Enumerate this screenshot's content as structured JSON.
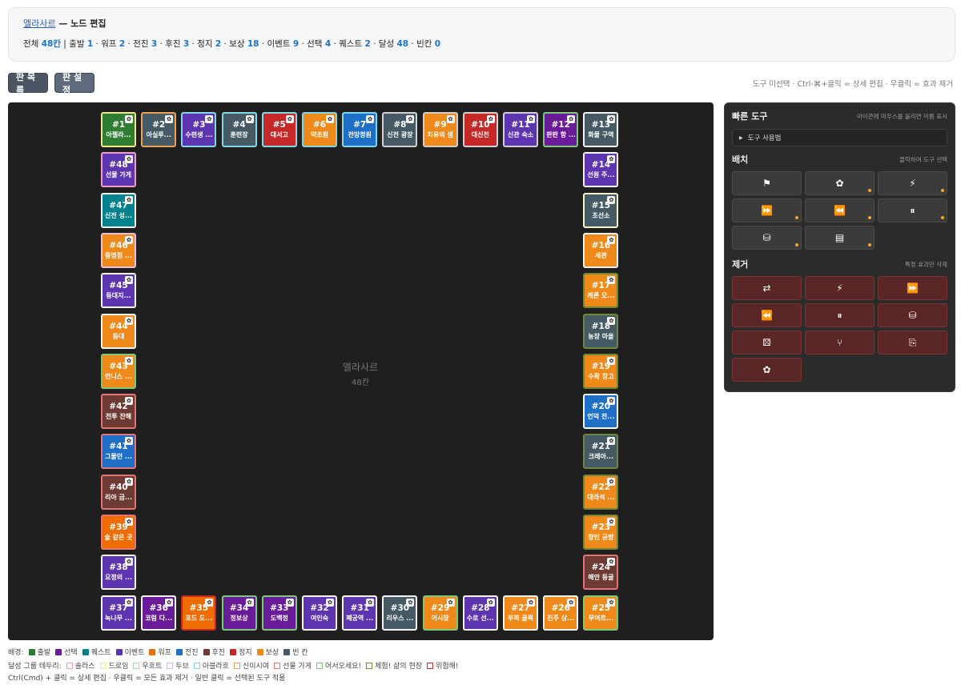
{
  "header": {
    "board_link": "엘라사르",
    "title_rest": " — 노드 편집",
    "stats": [
      {
        "label": "전체",
        "value": "48칸"
      },
      {
        "label": "출발",
        "value": "1"
      },
      {
        "label": "워프",
        "value": "2"
      },
      {
        "label": "전진",
        "value": "3"
      },
      {
        "label": "후진",
        "value": "3"
      },
      {
        "label": "정지",
        "value": "2"
      },
      {
        "label": "보상",
        "value": "18"
      },
      {
        "label": "이벤트",
        "value": "9"
      },
      {
        "label": "선택",
        "value": "4"
      },
      {
        "label": "퀘스트",
        "value": "2"
      },
      {
        "label": "달성",
        "value": "48"
      },
      {
        "label": "빈칸",
        "value": "0"
      }
    ]
  },
  "toolbar": {
    "board_list_label": "판 목록",
    "board_settings_label": "판 설정",
    "hint": "도구 미선택 · Ctrl-⌘+클릭 = 상세 편집 · 우클릭 = 효과 제거"
  },
  "board": {
    "name": "엘라사르",
    "count": "48칸",
    "tiles": [
      {
        "num": "#1",
        "name": "아젤라...",
        "bg": "#2e7d32",
        "border": "#f0e68c",
        "icon": "✿"
      },
      {
        "num": "#2",
        "name": "아실루...",
        "bg": "#455a64",
        "border": "#f0a050",
        "icon": "✿"
      },
      {
        "num": "#3",
        "name": "수련생 ...",
        "bg": "#5e35b1",
        "border": "#7fd8e8",
        "icon": "✿"
      },
      {
        "num": "#4",
        "name": "훈련장",
        "bg": "#455a64",
        "border": "#7fd8e8",
        "icon": "✿"
      },
      {
        "num": "#5",
        "name": "대서고",
        "bg": "#c62828",
        "border": "#7fd8e8",
        "icon": "✿"
      },
      {
        "num": "#6",
        "name": "약초원",
        "bg": "#ef8a1a",
        "border": "#7fd8e8",
        "icon": "✿"
      },
      {
        "num": "#7",
        "name": "전망정원",
        "bg": "#1e6fc7",
        "border": "#7fd8e8",
        "icon": "✿"
      },
      {
        "num": "#8",
        "name": "신전 광장",
        "bg": "#455a64",
        "border": "#d0d0d0",
        "icon": "✿"
      },
      {
        "num": "#9",
        "name": "치유의 샘",
        "bg": "#ef8a1a",
        "border": "#d0d0d0",
        "icon": "✿"
      },
      {
        "num": "#10",
        "name": "대신전",
        "bg": "#c62828",
        "border": "#d0d0d0",
        "icon": "✿"
      },
      {
        "num": "#11",
        "name": "신관 숙소",
        "bg": "#5e35b1",
        "border": "#d0d0d0",
        "icon": "✿"
      },
      {
        "num": "#12",
        "name": "판판 항 ...",
        "bg": "#6a1b9a",
        "border": "#7ec87e",
        "icon": "✿"
      },
      {
        "num": "#13",
        "name": "화물 구역",
        "bg": "#455a64",
        "border": "#f5f5f5",
        "icon": "✿"
      },
      {
        "num": "#14",
        "name": "선원 주...",
        "bg": "#5e35b1",
        "border": "#f5f5f5",
        "icon": "✿"
      },
      {
        "num": "#15",
        "name": "조선소",
        "bg": "#455a64",
        "border": "#f5f5c8",
        "icon": "✿"
      },
      {
        "num": "#16",
        "name": "세관",
        "bg": "#ef8a1a",
        "border": "#f5f5f5",
        "icon": "✿"
      },
      {
        "num": "#17",
        "name": "케른 오...",
        "bg": "#ef8a1a",
        "border": "#6a8a3a",
        "icon": "✿"
      },
      {
        "num": "#18",
        "name": "농장 마을",
        "bg": "#455a64",
        "border": "#6a8a3a",
        "icon": "✿"
      },
      {
        "num": "#19",
        "name": "수확 창고",
        "bg": "#ef8a1a",
        "border": "#6a8a3a",
        "icon": "✿"
      },
      {
        "num": "#20",
        "name": "언덕 전...",
        "bg": "#1e6fc7",
        "border": "#f5f5f5",
        "icon": "✿"
      },
      {
        "num": "#21",
        "name": "크레아...",
        "bg": "#455a64",
        "border": "#6a8a3a",
        "icon": "✿"
      },
      {
        "num": "#22",
        "name": "대라석 ...",
        "bg": "#ef8a1a",
        "border": "#6a8a3a",
        "icon": "✿"
      },
      {
        "num": "#23",
        "name": "장인 공방",
        "bg": "#ef8a1a",
        "border": "#6a8a3a",
        "icon": "✿"
      },
      {
        "num": "#24",
        "name": "해안 등굴",
        "bg": "#6d3b33",
        "border": "#e57373",
        "icon": "✿"
      },
      {
        "num": "#25",
        "name": "무여르...",
        "bg": "#ef8a1a",
        "border": "#7ec87e",
        "icon": "✿"
      },
      {
        "num": "#26",
        "name": "진주 상...",
        "bg": "#ef8a1a",
        "border": "#f5f5f5",
        "icon": "✿"
      },
      {
        "num": "#27",
        "name": "부적 골목",
        "bg": "#ef8a1a",
        "border": "#f5f5f5",
        "icon": "✿"
      },
      {
        "num": "#28",
        "name": "수로 선...",
        "bg": "#5e35b1",
        "border": "#f5f5f5",
        "icon": "✿"
      },
      {
        "num": "#29",
        "name": "어시장",
        "bg": "#ef8a1a",
        "border": "#7ec87e",
        "icon": "✿"
      },
      {
        "num": "#30",
        "name": "리우스 ...",
        "bg": "#455a64",
        "border": "#f5f5f5",
        "icon": "✿"
      },
      {
        "num": "#31",
        "name": "폐궁역 ...",
        "bg": "#5e35b1",
        "border": "#f5f5f5",
        "icon": "✿"
      },
      {
        "num": "#32",
        "name": "여인숙",
        "bg": "#5e35b1",
        "border": "#f5f5f5",
        "icon": "✿"
      },
      {
        "num": "#33",
        "name": "도백정",
        "bg": "#6a1b9a",
        "border": "#7ec87e",
        "icon": "✿"
      },
      {
        "num": "#34",
        "name": "정보상",
        "bg": "#6a1b9a",
        "border": "#7ec87e",
        "icon": "✿"
      },
      {
        "num": "#35",
        "name": "포드 도...",
        "bg": "#ef6c00",
        "border": "#c62828",
        "icon": "✿"
      },
      {
        "num": "#36",
        "name": "코럼 다...",
        "bg": "#6a1b9a",
        "border": "#f5f5f5",
        "icon": "✿"
      },
      {
        "num": "#37",
        "name": "녹나무 ...",
        "bg": "#5e35b1",
        "border": "#f5f5f5",
        "icon": "✿"
      },
      {
        "num": "#38",
        "name": "요정의 ...",
        "bg": "#5e35b1",
        "border": "#f5f5f5",
        "icon": "✿"
      },
      {
        "num": "#39",
        "name": "술 같은 곳",
        "bg": "#ef6c00",
        "border": "#e57373",
        "icon": "✿"
      },
      {
        "num": "#40",
        "name": "리아 금...",
        "bg": "#6d3b33",
        "border": "#e57373",
        "icon": "✿"
      },
      {
        "num": "#41",
        "name": "그물던 ...",
        "bg": "#1e6fc7",
        "border": "#e57373",
        "icon": "✿"
      },
      {
        "num": "#42",
        "name": "전투 잔해",
        "bg": "#6d3b33",
        "border": "#e57373",
        "icon": "✿"
      },
      {
        "num": "#43",
        "name": "언니스 ...",
        "bg": "#ef8a1a",
        "border": "#7ec87e",
        "icon": "✿"
      },
      {
        "num": "#44",
        "name": "등대",
        "bg": "#ef8a1a",
        "border": "#f5f5f5",
        "icon": "✿"
      },
      {
        "num": "#45",
        "name": "등대지...",
        "bg": "#5e35b1",
        "border": "#f5f5f5",
        "icon": "✿"
      },
      {
        "num": "#46",
        "name": "증명점 ...",
        "bg": "#ef8a1a",
        "border": "#f0c0e0",
        "icon": "✿"
      },
      {
        "num": "#47",
        "name": "신전 성...",
        "bg": "#00838f",
        "border": "#f5f5f5",
        "icon": "✿"
      },
      {
        "num": "#48",
        "name": "선물 가게",
        "bg": "#5e35b1",
        "border": "#f0a0c8",
        "icon": "✿"
      }
    ]
  },
  "panel": {
    "quick_tools_title": "빠른 도구",
    "quick_tools_hint": "아이콘에 마우스를 올리면 이름 표시",
    "usage_label": "도구 사용법",
    "placement_title": "배치",
    "placement_hint": "클릭하여 도구 선택",
    "placement_tools": [
      {
        "icon": "flag-icon",
        "glyph": "⚑",
        "dot": false
      },
      {
        "icon": "award-icon",
        "glyph": "✿",
        "dot": true
      },
      {
        "icon": "bolt-icon",
        "glyph": "⚡",
        "dot": true
      },
      {
        "icon": "fast-forward-icon",
        "glyph": "⏩",
        "dot": true
      },
      {
        "icon": "rewind-icon",
        "glyph": "⏪",
        "dot": true
      },
      {
        "icon": "pause-icon",
        "glyph": "⏸",
        "dot": true
      },
      {
        "icon": "coins-icon",
        "glyph": "⛁",
        "dot": true
      },
      {
        "icon": "chest-icon",
        "glyph": "▤",
        "dot": true
      }
    ],
    "remove_title": "제거",
    "remove_hint": "특정 효과만 삭제",
    "remove_tools": [
      {
        "icon": "swap-icon",
        "glyph": "⇄"
      },
      {
        "icon": "bolt-icon",
        "glyph": "⚡"
      },
      {
        "icon": "fast-forward-icon",
        "glyph": "⏩"
      },
      {
        "icon": "rewind-icon",
        "glyph": "⏪"
      },
      {
        "icon": "pause-icon",
        "glyph": "⏸"
      },
      {
        "icon": "coins-icon",
        "glyph": "⛁"
      },
      {
        "icon": "dice-icon",
        "glyph": "⚄"
      },
      {
        "icon": "fork-icon",
        "glyph": "⑂"
      },
      {
        "icon": "scroll-icon",
        "glyph": "⎘"
      },
      {
        "icon": "award-icon",
        "glyph": "✿"
      }
    ]
  },
  "legend": {
    "bg_label": "배경:",
    "bg_items": [
      {
        "label": "출발",
        "color": "#2e7d32"
      },
      {
        "label": "선택",
        "color": "#6a1b9a"
      },
      {
        "label": "퀘스트",
        "color": "#00838f"
      },
      {
        "label": "이벤트",
        "color": "#5e35b1"
      },
      {
        "label": "워프",
        "color": "#ef6c00"
      },
      {
        "label": "전진",
        "color": "#1e6fc7"
      },
      {
        "label": "후진",
        "color": "#6d3b33"
      },
      {
        "label": "정지",
        "color": "#c62828"
      },
      {
        "label": "보상",
        "color": "#ef8a1a"
      },
      {
        "label": "빈 칸",
        "color": "#455a64"
      }
    ],
    "group_label": "달성 그룹 테두리:",
    "group_items": [
      {
        "label": "솔라스",
        "color": "#f0a0c8"
      },
      {
        "label": "드로임",
        "color": "#f0e68c"
      },
      {
        "label": "우흐트",
        "color": "#b0d8b0"
      },
      {
        "label": "두브",
        "color": "#c0c0e8"
      },
      {
        "label": "아블라흐",
        "color": "#7fd8e8"
      },
      {
        "label": "신이시여",
        "color": "#f0a050"
      },
      {
        "label": "선물 가게",
        "color": "#e57373"
      },
      {
        "label": "어서오세요!",
        "color": "#7ec87e"
      },
      {
        "label": "체험! 삶의 현장",
        "color": "#6a8a3a"
      },
      {
        "label": "위험해!",
        "color": "#c62828"
      }
    ],
    "footer": "Ctrl(Cmd) + 클릭 = 상세 편집 · 우클릭 = 모든 효과 제거 · 일반 클릭 = 선택된 도구 적용"
  }
}
